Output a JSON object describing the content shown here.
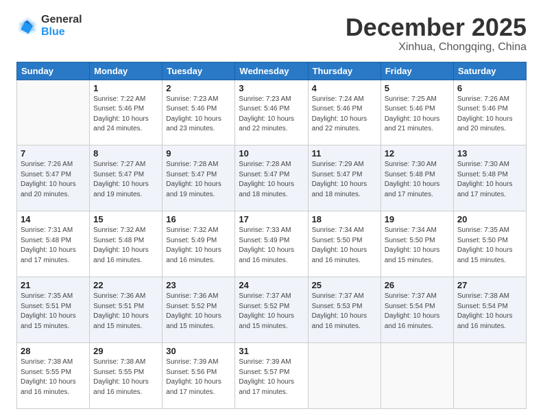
{
  "logo": {
    "general": "General",
    "blue": "Blue"
  },
  "header": {
    "month": "December 2025",
    "location": "Xinhua, Chongqing, China"
  },
  "weekdays": [
    "Sunday",
    "Monday",
    "Tuesday",
    "Wednesday",
    "Thursday",
    "Friday",
    "Saturday"
  ],
  "weeks": [
    [
      {
        "day": "",
        "info": ""
      },
      {
        "day": "1",
        "info": "Sunrise: 7:22 AM\nSunset: 5:46 PM\nDaylight: 10 hours\nand 24 minutes."
      },
      {
        "day": "2",
        "info": "Sunrise: 7:23 AM\nSunset: 5:46 PM\nDaylight: 10 hours\nand 23 minutes."
      },
      {
        "day": "3",
        "info": "Sunrise: 7:23 AM\nSunset: 5:46 PM\nDaylight: 10 hours\nand 22 minutes."
      },
      {
        "day": "4",
        "info": "Sunrise: 7:24 AM\nSunset: 5:46 PM\nDaylight: 10 hours\nand 22 minutes."
      },
      {
        "day": "5",
        "info": "Sunrise: 7:25 AM\nSunset: 5:46 PM\nDaylight: 10 hours\nand 21 minutes."
      },
      {
        "day": "6",
        "info": "Sunrise: 7:26 AM\nSunset: 5:46 PM\nDaylight: 10 hours\nand 20 minutes."
      }
    ],
    [
      {
        "day": "7",
        "info": "Sunrise: 7:26 AM\nSunset: 5:47 PM\nDaylight: 10 hours\nand 20 minutes."
      },
      {
        "day": "8",
        "info": "Sunrise: 7:27 AM\nSunset: 5:47 PM\nDaylight: 10 hours\nand 19 minutes."
      },
      {
        "day": "9",
        "info": "Sunrise: 7:28 AM\nSunset: 5:47 PM\nDaylight: 10 hours\nand 19 minutes."
      },
      {
        "day": "10",
        "info": "Sunrise: 7:28 AM\nSunset: 5:47 PM\nDaylight: 10 hours\nand 18 minutes."
      },
      {
        "day": "11",
        "info": "Sunrise: 7:29 AM\nSunset: 5:47 PM\nDaylight: 10 hours\nand 18 minutes."
      },
      {
        "day": "12",
        "info": "Sunrise: 7:30 AM\nSunset: 5:48 PM\nDaylight: 10 hours\nand 17 minutes."
      },
      {
        "day": "13",
        "info": "Sunrise: 7:30 AM\nSunset: 5:48 PM\nDaylight: 10 hours\nand 17 minutes."
      }
    ],
    [
      {
        "day": "14",
        "info": "Sunrise: 7:31 AM\nSunset: 5:48 PM\nDaylight: 10 hours\nand 17 minutes."
      },
      {
        "day": "15",
        "info": "Sunrise: 7:32 AM\nSunset: 5:48 PM\nDaylight: 10 hours\nand 16 minutes."
      },
      {
        "day": "16",
        "info": "Sunrise: 7:32 AM\nSunset: 5:49 PM\nDaylight: 10 hours\nand 16 minutes."
      },
      {
        "day": "17",
        "info": "Sunrise: 7:33 AM\nSunset: 5:49 PM\nDaylight: 10 hours\nand 16 minutes."
      },
      {
        "day": "18",
        "info": "Sunrise: 7:34 AM\nSunset: 5:50 PM\nDaylight: 10 hours\nand 16 minutes."
      },
      {
        "day": "19",
        "info": "Sunrise: 7:34 AM\nSunset: 5:50 PM\nDaylight: 10 hours\nand 15 minutes."
      },
      {
        "day": "20",
        "info": "Sunrise: 7:35 AM\nSunset: 5:50 PM\nDaylight: 10 hours\nand 15 minutes."
      }
    ],
    [
      {
        "day": "21",
        "info": "Sunrise: 7:35 AM\nSunset: 5:51 PM\nDaylight: 10 hours\nand 15 minutes."
      },
      {
        "day": "22",
        "info": "Sunrise: 7:36 AM\nSunset: 5:51 PM\nDaylight: 10 hours\nand 15 minutes."
      },
      {
        "day": "23",
        "info": "Sunrise: 7:36 AM\nSunset: 5:52 PM\nDaylight: 10 hours\nand 15 minutes."
      },
      {
        "day": "24",
        "info": "Sunrise: 7:37 AM\nSunset: 5:52 PM\nDaylight: 10 hours\nand 15 minutes."
      },
      {
        "day": "25",
        "info": "Sunrise: 7:37 AM\nSunset: 5:53 PM\nDaylight: 10 hours\nand 16 minutes."
      },
      {
        "day": "26",
        "info": "Sunrise: 7:37 AM\nSunset: 5:54 PM\nDaylight: 10 hours\nand 16 minutes."
      },
      {
        "day": "27",
        "info": "Sunrise: 7:38 AM\nSunset: 5:54 PM\nDaylight: 10 hours\nand 16 minutes."
      }
    ],
    [
      {
        "day": "28",
        "info": "Sunrise: 7:38 AM\nSunset: 5:55 PM\nDaylight: 10 hours\nand 16 minutes."
      },
      {
        "day": "29",
        "info": "Sunrise: 7:38 AM\nSunset: 5:55 PM\nDaylight: 10 hours\nand 16 minutes."
      },
      {
        "day": "30",
        "info": "Sunrise: 7:39 AM\nSunset: 5:56 PM\nDaylight: 10 hours\nand 17 minutes."
      },
      {
        "day": "31",
        "info": "Sunrise: 7:39 AM\nSunset: 5:57 PM\nDaylight: 10 hours\nand 17 minutes."
      },
      {
        "day": "",
        "info": ""
      },
      {
        "day": "",
        "info": ""
      },
      {
        "day": "",
        "info": ""
      }
    ]
  ]
}
